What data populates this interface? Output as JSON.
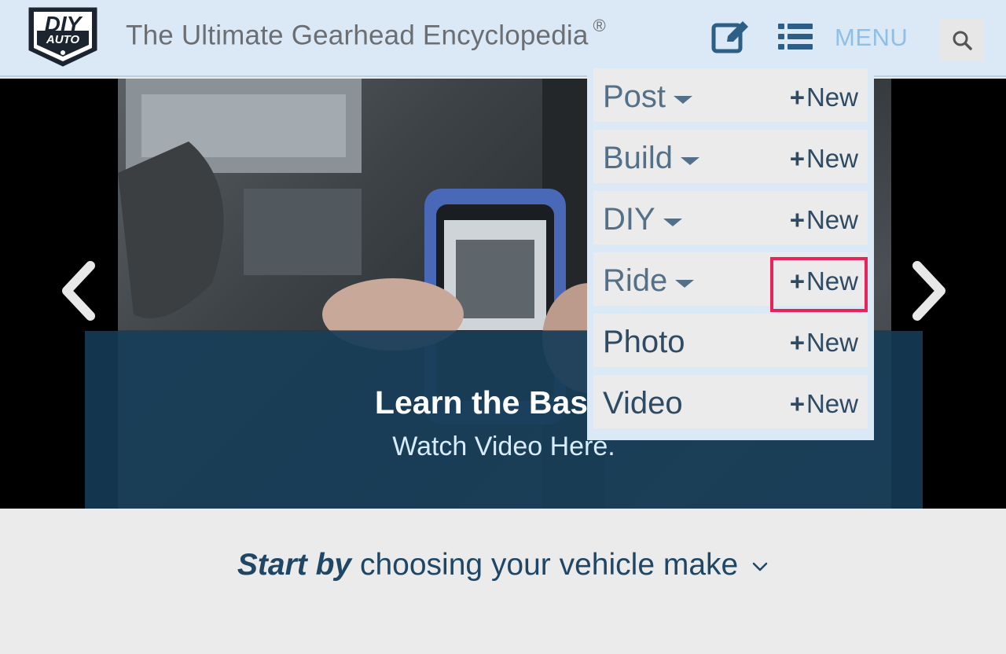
{
  "header": {
    "logo_line1": "DIY",
    "logo_line2": "AUTO",
    "title": "The Ultimate Gearhead Encyclopedia",
    "title_mark": "®",
    "edit_icon": "edit-icon",
    "list_icon": "list-icon",
    "menu_label": "MENU",
    "search_icon": "search-icon"
  },
  "hero": {
    "caption_title": "Learn the Basics",
    "caption_link": "Watch Video Here."
  },
  "dropdown": {
    "items": [
      {
        "label": "Post",
        "has_caret": true,
        "new_label": "New"
      },
      {
        "label": "Build",
        "has_caret": true,
        "new_label": "New"
      },
      {
        "label": "DIY",
        "has_caret": true,
        "new_label": "New"
      },
      {
        "label": "Ride",
        "has_caret": true,
        "new_label": "New"
      },
      {
        "label": "Photo",
        "has_caret": false,
        "new_label": "New"
      },
      {
        "label": "Video",
        "has_caret": false,
        "new_label": "New"
      }
    ],
    "plus": "+"
  },
  "bottom": {
    "start_bold": "Start by",
    "start_rest": "choosing your vehicle make"
  },
  "colors": {
    "header_bg": "#dbe9f6",
    "menu_text": "#8dc0e6",
    "caption_bg": "#163f5c",
    "highlight": "#e8225a",
    "label_blue": "#547089"
  }
}
